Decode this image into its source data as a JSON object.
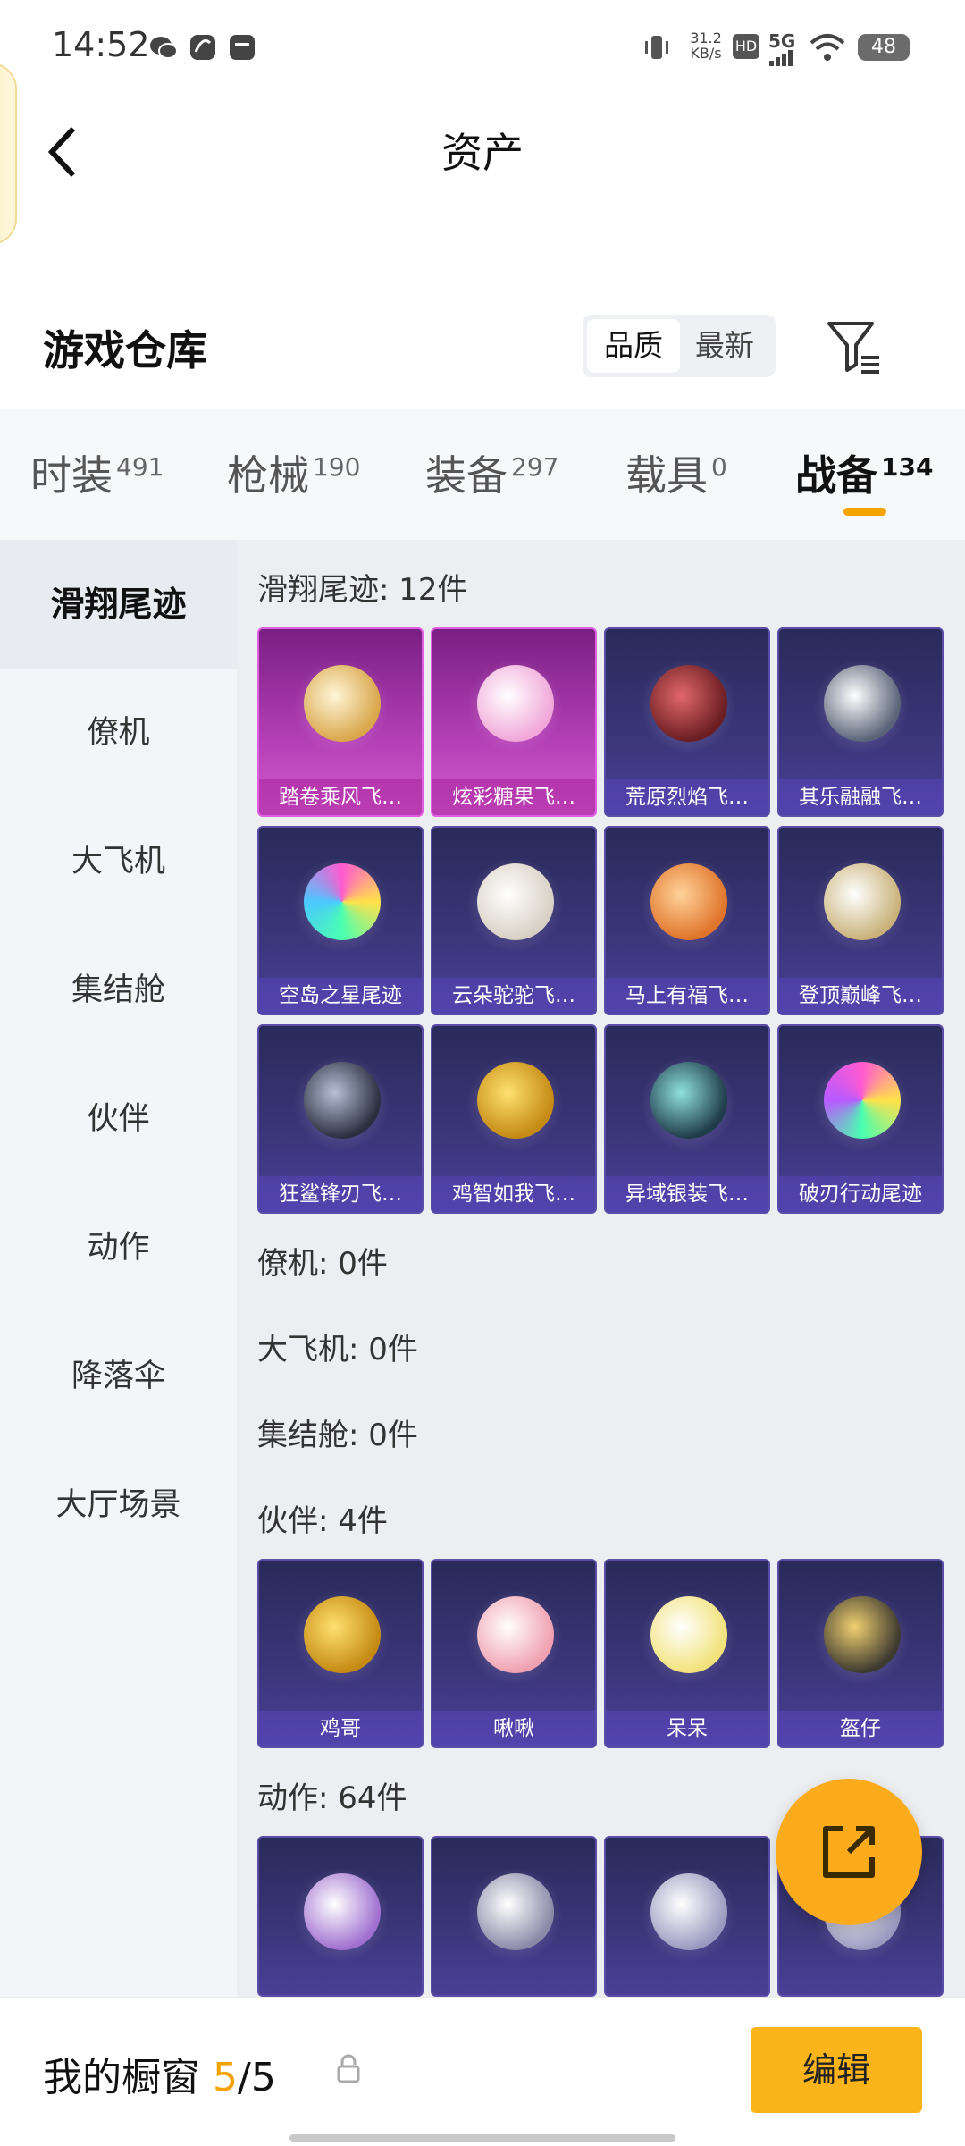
{
  "status_bar": {
    "time": "14:52",
    "speed_value": "31.2",
    "speed_unit": "KB/s",
    "hd": "HD",
    "network": "5G",
    "battery": "48"
  },
  "header": {
    "title": "资产"
  },
  "warehouse": {
    "title": "游戏仓库",
    "sort_quality": "品质",
    "sort_latest": "最新"
  },
  "tabs": [
    {
      "label": "时装",
      "count": "491"
    },
    {
      "label": "枪械",
      "count": "190"
    },
    {
      "label": "装备",
      "count": "297"
    },
    {
      "label": "载具",
      "count": "0"
    },
    {
      "label": "战备",
      "count": "134"
    }
  ],
  "sidebar": {
    "items": [
      "滑翔尾迹",
      "僚机",
      "大飞机",
      "集结舱",
      "伙伴",
      "动作",
      "降落伞",
      "大厅场景"
    ]
  },
  "sections": {
    "glide": {
      "title": "滑翔尾迹: 12件",
      "items": [
        "踏卷乘风飞…",
        "炫彩糖果飞…",
        "荒原烈焰飞…",
        "其乐融融飞…",
        "空岛之星尾迹",
        "云朵驼驼飞…",
        "马上有福飞…",
        "登顶巅峰飞…",
        "狂鲨锋刃飞…",
        "鸡智如我飞…",
        "异域银装飞…",
        "破刃行动尾迹"
      ]
    },
    "wingman": {
      "title": "僚机: 0件"
    },
    "plane": {
      "title": "大飞机: 0件"
    },
    "capsule": {
      "title": "集结舱: 0件"
    },
    "partner": {
      "title": "伙伴: 4件",
      "items": [
        "鸡哥",
        "啾啾",
        "呆呆",
        "盔仔"
      ]
    },
    "action": {
      "title": "动作: 64件"
    }
  },
  "colors": {
    "accent": "#f5a300",
    "card_purple": "#3a3578",
    "card_pink": "#b43fb6"
  },
  "bottom": {
    "showcase_label": "我的橱窗",
    "count_now": "5",
    "count_sep": "/",
    "count_total": "5",
    "edit_label": "编辑"
  }
}
